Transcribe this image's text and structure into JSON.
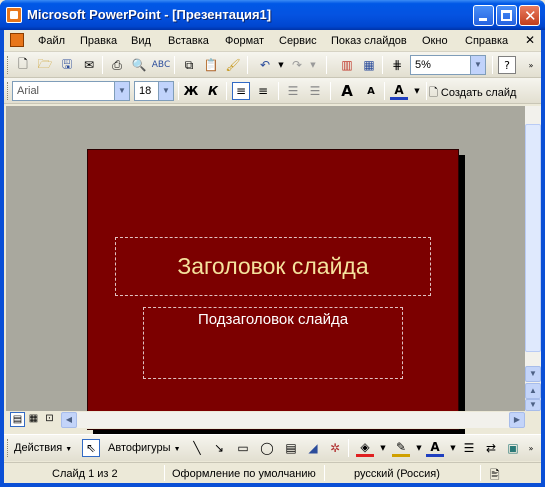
{
  "window": {
    "title": "Microsoft PowerPoint - [Презентация1]"
  },
  "menu": [
    "Файл",
    "Правка",
    "Вид",
    "Вставка",
    "Формат",
    "Сервис",
    "Показ слайдов",
    "Окно",
    "Справка"
  ],
  "standard_toolbar": {
    "zoom": "5%"
  },
  "format_toolbar": {
    "font": "Arial",
    "size": "18",
    "bold": "Ж",
    "italic": "К",
    "create_slide": "Создать слайд"
  },
  "slide": {
    "title": "Заголовок слайда",
    "subtitle": "Подзаголовок слайда",
    "background": "#7c0000"
  },
  "drawing_toolbar": {
    "actions": "Действия",
    "autoshapes": "Автофигуры"
  },
  "status": {
    "slide": "Слайд 1 из 2",
    "design": "Оформление по умолчанию",
    "language": "русский (Россия)"
  }
}
